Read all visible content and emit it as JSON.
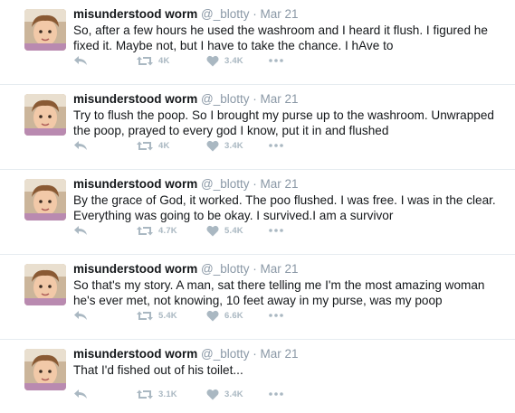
{
  "tweets": [
    {
      "name": "misunderstood worm",
      "handle": "@_blotty",
      "sep": "·",
      "date": "Mar 21",
      "text": "So, after a few hours he used the washroom and I heard it flush. I figured he fixed it. Maybe not, but I have to take the chance. I hAve to",
      "retweets": "4K",
      "likes": "3.4K"
    },
    {
      "name": "misunderstood worm",
      "handle": "@_blotty",
      "sep": "·",
      "date": "Mar 21",
      "text": "Try to flush the poop. So I brought my purse up to the washroom. Unwrapped the poop, prayed to every god I know, put it in and flushed",
      "retweets": "4K",
      "likes": "3.4K"
    },
    {
      "name": "misunderstood worm",
      "handle": "@_blotty",
      "sep": "·",
      "date": "Mar 21",
      "text": "By the grace of God, it worked. The poo flushed. I was free. I was in the clear. Everything was going to be okay. I survived.I am a survivor",
      "retweets": "4.7K",
      "likes": "5.4K"
    },
    {
      "name": "misunderstood worm",
      "handle": "@_blotty",
      "sep": "·",
      "date": "Mar 21",
      "text": "So that's my story. A man, sat there telling me I'm the most amazing woman he's ever met, not knowing, 10 feet away in my purse, was my poop",
      "retweets": "5.4K",
      "likes": "6.6K"
    },
    {
      "name": "misunderstood worm",
      "handle": "@_blotty",
      "sep": "·",
      "date": "Mar 21",
      "text": "That I'd fished out of his toilet...",
      "retweets": "3.1K",
      "likes": "3.4K"
    }
  ],
  "icons": {
    "reply": "reply-icon",
    "retweet": "retweet-icon",
    "like": "heart-icon",
    "more": "more-dots-icon"
  },
  "colors": {
    "icon": "#aab8c2",
    "muted": "#8a98a6",
    "text": "#14171a",
    "divider": "#e6ecf0"
  }
}
